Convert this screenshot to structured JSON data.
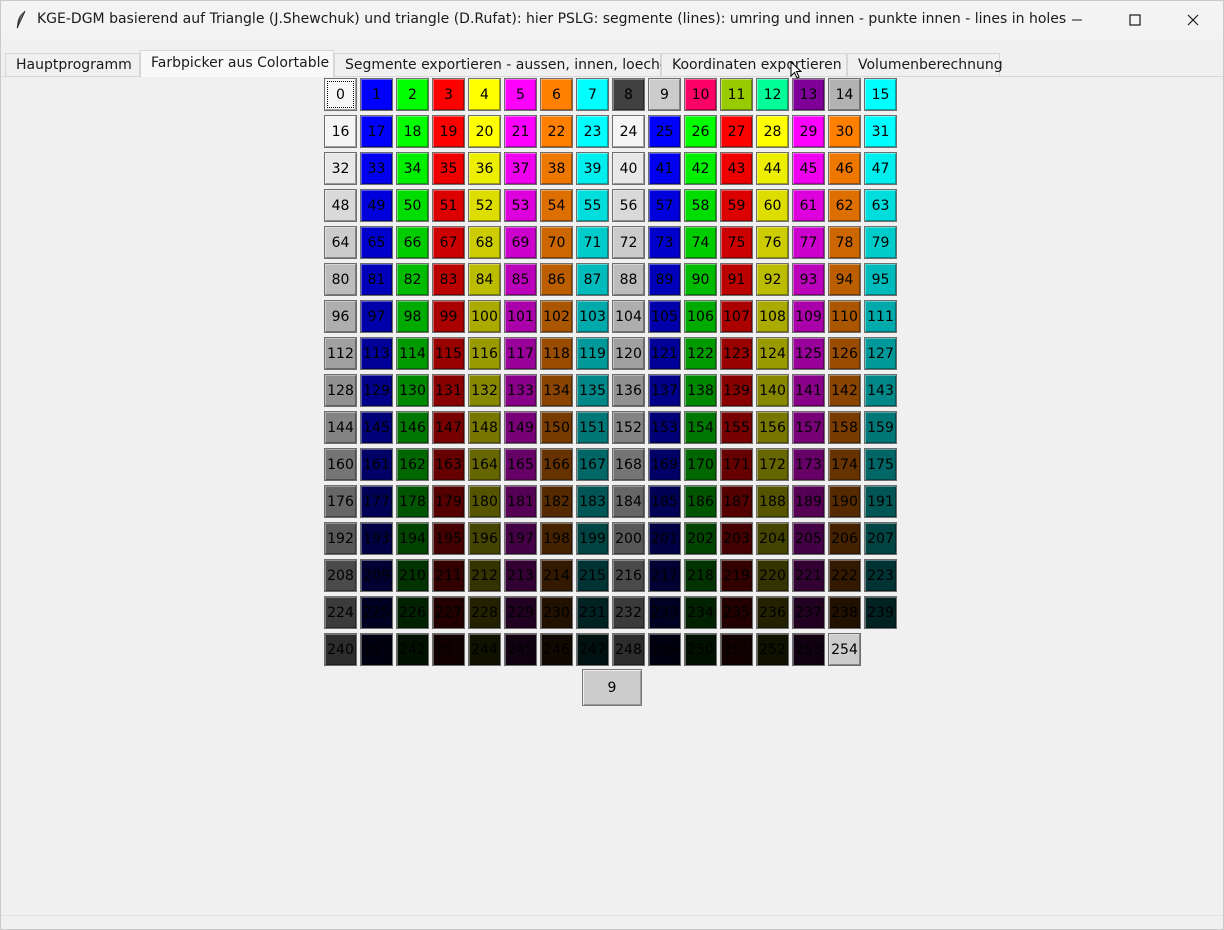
{
  "window": {
    "title": "KGE-DGM basierend auf Triangle (J.Shewchuk) und triangle (D.Rufat): hier PSLG: segmente (lines): umring und innen - punkte innen - lines in holes",
    "buttons": {
      "minimize": "minimize-icon",
      "maximize": "maximize-icon",
      "close": "close-icon"
    }
  },
  "tabs": [
    {
      "label": "Hauptprogramm",
      "active": false
    },
    {
      "label": "Farbpicker aus Colortable",
      "active": true
    },
    {
      "label": "Segmente exportieren - aussen, innen, loecher",
      "active": false
    },
    {
      "label": "Koordinaten exportieren",
      "active": false
    },
    {
      "label": "Volumenberechnung",
      "active": false
    }
  ],
  "colortable": {
    "columns": 16,
    "selected_index": 0,
    "cells": [
      {
        "label": "0",
        "color": "#f7f7f7"
      },
      {
        "label": "1",
        "color": "#0000ff"
      },
      {
        "label": "2",
        "color": "#00ff00"
      },
      {
        "label": "3",
        "color": "#ff0000"
      },
      {
        "label": "4",
        "color": "#ffff00"
      },
      {
        "label": "5",
        "color": "#ff00ff"
      },
      {
        "label": "6",
        "color": "#ff7f00"
      },
      {
        "label": "7",
        "color": "#00ffff"
      },
      {
        "label": "8",
        "color": "#414141"
      },
      {
        "label": "9",
        "color": "#cccccc"
      },
      {
        "label": "10",
        "color": "#ff0066"
      },
      {
        "label": "11",
        "color": "#99cc00"
      },
      {
        "label": "12",
        "color": "#00ff99"
      },
      {
        "label": "13",
        "color": "#7f0099"
      },
      {
        "label": "14",
        "color": "#b2b2b2"
      },
      {
        "label": "15",
        "color": "#00ffff"
      },
      {
        "label": "16",
        "color": "#f5f5f5"
      },
      {
        "label": "17",
        "color": "#0000ff"
      },
      {
        "label": "18",
        "color": "#00ff00"
      },
      {
        "label": "19",
        "color": "#ff0000"
      },
      {
        "label": "20",
        "color": "#ffff00"
      },
      {
        "label": "21",
        "color": "#ff00ff"
      },
      {
        "label": "22",
        "color": "#ff7f00"
      },
      {
        "label": "23",
        "color": "#00ffff"
      },
      {
        "label": "24",
        "color": "#f5f5f5"
      },
      {
        "label": "25",
        "color": "#0000ff"
      },
      {
        "label": "26",
        "color": "#00ff00"
      },
      {
        "label": "27",
        "color": "#ff0000"
      },
      {
        "label": "28",
        "color": "#ffff00"
      },
      {
        "label": "29",
        "color": "#ff00ff"
      },
      {
        "label": "30",
        "color": "#ff7f00"
      },
      {
        "label": "31",
        "color": "#00ffff"
      },
      {
        "label": "32",
        "color": "#e8e8e8"
      },
      {
        "label": "33",
        "color": "#0000ee"
      },
      {
        "label": "34",
        "color": "#00ee00"
      },
      {
        "label": "35",
        "color": "#ee0000"
      },
      {
        "label": "36",
        "color": "#eeee00"
      },
      {
        "label": "37",
        "color": "#ee00ee"
      },
      {
        "label": "38",
        "color": "#ee7700"
      },
      {
        "label": "39",
        "color": "#00eeee"
      },
      {
        "label": "40",
        "color": "#e8e8e8"
      },
      {
        "label": "41",
        "color": "#0000ee"
      },
      {
        "label": "42",
        "color": "#00ee00"
      },
      {
        "label": "43",
        "color": "#ee0000"
      },
      {
        "label": "44",
        "color": "#eeee00"
      },
      {
        "label": "45",
        "color": "#ee00ee"
      },
      {
        "label": "46",
        "color": "#ee7700"
      },
      {
        "label": "47",
        "color": "#00eeee"
      },
      {
        "label": "48",
        "color": "#d9d9d9"
      },
      {
        "label": "49",
        "color": "#0000dd"
      },
      {
        "label": "50",
        "color": "#00dd00"
      },
      {
        "label": "51",
        "color": "#dd0000"
      },
      {
        "label": "52",
        "color": "#dddd00"
      },
      {
        "label": "53",
        "color": "#dd00dd"
      },
      {
        "label": "54",
        "color": "#dd6f00"
      },
      {
        "label": "55",
        "color": "#00dddd"
      },
      {
        "label": "56",
        "color": "#d9d9d9"
      },
      {
        "label": "57",
        "color": "#0000dd"
      },
      {
        "label": "58",
        "color": "#00dd00"
      },
      {
        "label": "59",
        "color": "#dd0000"
      },
      {
        "label": "60",
        "color": "#dddd00"
      },
      {
        "label": "61",
        "color": "#dd00dd"
      },
      {
        "label": "62",
        "color": "#dd6f00"
      },
      {
        "label": "63",
        "color": "#00dddd"
      },
      {
        "label": "64",
        "color": "#cbcbcb"
      },
      {
        "label": "65",
        "color": "#0000cc"
      },
      {
        "label": "66",
        "color": "#00cc00"
      },
      {
        "label": "67",
        "color": "#cc0000"
      },
      {
        "label": "68",
        "color": "#cccc00"
      },
      {
        "label": "69",
        "color": "#cc00cc"
      },
      {
        "label": "70",
        "color": "#cc6600"
      },
      {
        "label": "71",
        "color": "#00cccc"
      },
      {
        "label": "72",
        "color": "#cbcbcb"
      },
      {
        "label": "73",
        "color": "#0000cc"
      },
      {
        "label": "74",
        "color": "#00cc00"
      },
      {
        "label": "75",
        "color": "#cc0000"
      },
      {
        "label": "76",
        "color": "#cccc00"
      },
      {
        "label": "77",
        "color": "#cc00cc"
      },
      {
        "label": "78",
        "color": "#cc6600"
      },
      {
        "label": "79",
        "color": "#00cccc"
      },
      {
        "label": "80",
        "color": "#bcbcbc"
      },
      {
        "label": "81",
        "color": "#0000bb"
      },
      {
        "label": "82",
        "color": "#00bb00"
      },
      {
        "label": "83",
        "color": "#bb0000"
      },
      {
        "label": "84",
        "color": "#bbbb00"
      },
      {
        "label": "85",
        "color": "#bb00bb"
      },
      {
        "label": "86",
        "color": "#bb5e00"
      },
      {
        "label": "87",
        "color": "#00bbbb"
      },
      {
        "label": "88",
        "color": "#bcbcbc"
      },
      {
        "label": "89",
        "color": "#0000bb"
      },
      {
        "label": "90",
        "color": "#00bb00"
      },
      {
        "label": "91",
        "color": "#bb0000"
      },
      {
        "label": "92",
        "color": "#bbbb00"
      },
      {
        "label": "93",
        "color": "#bb00bb"
      },
      {
        "label": "94",
        "color": "#bb5e00"
      },
      {
        "label": "95",
        "color": "#00bbbb"
      },
      {
        "label": "96",
        "color": "#aeaeae"
      },
      {
        "label": "97",
        "color": "#0000aa"
      },
      {
        "label": "98",
        "color": "#00aa00"
      },
      {
        "label": "99",
        "color": "#aa0000"
      },
      {
        "label": "100",
        "color": "#aaaa00"
      },
      {
        "label": "101",
        "color": "#aa00aa"
      },
      {
        "label": "102",
        "color": "#aa5500"
      },
      {
        "label": "103",
        "color": "#00aaaa"
      },
      {
        "label": "104",
        "color": "#aeaeae"
      },
      {
        "label": "105",
        "color": "#0000aa"
      },
      {
        "label": "106",
        "color": "#00aa00"
      },
      {
        "label": "107",
        "color": "#aa0000"
      },
      {
        "label": "108",
        "color": "#aaaa00"
      },
      {
        "label": "109",
        "color": "#aa00aa"
      },
      {
        "label": "110",
        "color": "#aa5500"
      },
      {
        "label": "111",
        "color": "#00aaaa"
      },
      {
        "label": "112",
        "color": "#a0a0a0"
      },
      {
        "label": "113",
        "color": "#000099"
      },
      {
        "label": "114",
        "color": "#009900"
      },
      {
        "label": "115",
        "color": "#990000"
      },
      {
        "label": "116",
        "color": "#999900"
      },
      {
        "label": "117",
        "color": "#990099"
      },
      {
        "label": "118",
        "color": "#994c00"
      },
      {
        "label": "119",
        "color": "#009999"
      },
      {
        "label": "120",
        "color": "#a0a0a0"
      },
      {
        "label": "121",
        "color": "#000099"
      },
      {
        "label": "122",
        "color": "#009900"
      },
      {
        "label": "123",
        "color": "#990000"
      },
      {
        "label": "124",
        "color": "#999900"
      },
      {
        "label": "125",
        "color": "#990099"
      },
      {
        "label": "126",
        "color": "#994c00"
      },
      {
        "label": "127",
        "color": "#009999"
      },
      {
        "label": "128",
        "color": "#919191"
      },
      {
        "label": "129",
        "color": "#000088"
      },
      {
        "label": "130",
        "color": "#008800"
      },
      {
        "label": "131",
        "color": "#880000"
      },
      {
        "label": "132",
        "color": "#888800"
      },
      {
        "label": "133",
        "color": "#880088"
      },
      {
        "label": "134",
        "color": "#884400"
      },
      {
        "label": "135",
        "color": "#008888"
      },
      {
        "label": "136",
        "color": "#919191"
      },
      {
        "label": "137",
        "color": "#000088"
      },
      {
        "label": "138",
        "color": "#008800"
      },
      {
        "label": "139",
        "color": "#880000"
      },
      {
        "label": "140",
        "color": "#888800"
      },
      {
        "label": "141",
        "color": "#880088"
      },
      {
        "label": "142",
        "color": "#884400"
      },
      {
        "label": "143",
        "color": "#008888"
      },
      {
        "label": "144",
        "color": "#838383"
      },
      {
        "label": "145",
        "color": "#000077"
      },
      {
        "label": "146",
        "color": "#007700"
      },
      {
        "label": "147",
        "color": "#770000"
      },
      {
        "label": "148",
        "color": "#777700"
      },
      {
        "label": "149",
        "color": "#770077"
      },
      {
        "label": "150",
        "color": "#773b00"
      },
      {
        "label": "151",
        "color": "#007777"
      },
      {
        "label": "152",
        "color": "#838383"
      },
      {
        "label": "153",
        "color": "#000077"
      },
      {
        "label": "154",
        "color": "#007700"
      },
      {
        "label": "155",
        "color": "#770000"
      },
      {
        "label": "156",
        "color": "#777700"
      },
      {
        "label": "157",
        "color": "#770077"
      },
      {
        "label": "158",
        "color": "#773b00"
      },
      {
        "label": "159",
        "color": "#007777"
      },
      {
        "label": "160",
        "color": "#757575"
      },
      {
        "label": "161",
        "color": "#000066"
      },
      {
        "label": "162",
        "color": "#006600"
      },
      {
        "label": "163",
        "color": "#660000"
      },
      {
        "label": "164",
        "color": "#666600"
      },
      {
        "label": "165",
        "color": "#660066"
      },
      {
        "label": "166",
        "color": "#663300"
      },
      {
        "label": "167",
        "color": "#006666"
      },
      {
        "label": "168",
        "color": "#757575"
      },
      {
        "label": "169",
        "color": "#000066"
      },
      {
        "label": "170",
        "color": "#006600"
      },
      {
        "label": "171",
        "color": "#660000"
      },
      {
        "label": "172",
        "color": "#666600"
      },
      {
        "label": "173",
        "color": "#660066"
      },
      {
        "label": "174",
        "color": "#663300"
      },
      {
        "label": "175",
        "color": "#006666"
      },
      {
        "label": "176",
        "color": "#666666"
      },
      {
        "label": "177",
        "color": "#000055"
      },
      {
        "label": "178",
        "color": "#005500"
      },
      {
        "label": "179",
        "color": "#550000"
      },
      {
        "label": "180",
        "color": "#555500"
      },
      {
        "label": "181",
        "color": "#550055"
      },
      {
        "label": "182",
        "color": "#552a00"
      },
      {
        "label": "183",
        "color": "#005555"
      },
      {
        "label": "184",
        "color": "#666666"
      },
      {
        "label": "185",
        "color": "#000055"
      },
      {
        "label": "186",
        "color": "#005500"
      },
      {
        "label": "187",
        "color": "#550000"
      },
      {
        "label": "188",
        "color": "#555500"
      },
      {
        "label": "189",
        "color": "#550055"
      },
      {
        "label": "190",
        "color": "#552a00"
      },
      {
        "label": "191",
        "color": "#005555"
      },
      {
        "label": "192",
        "color": "#585858"
      },
      {
        "label": "193",
        "color": "#000044"
      },
      {
        "label": "194",
        "color": "#004400"
      },
      {
        "label": "195",
        "color": "#440000"
      },
      {
        "label": "196",
        "color": "#444400"
      },
      {
        "label": "197",
        "color": "#440044"
      },
      {
        "label": "198",
        "color": "#442200"
      },
      {
        "label": "199",
        "color": "#004444"
      },
      {
        "label": "200",
        "color": "#585858"
      },
      {
        "label": "201",
        "color": "#000044"
      },
      {
        "label": "202",
        "color": "#004400"
      },
      {
        "label": "203",
        "color": "#440000"
      },
      {
        "label": "204",
        "color": "#444400"
      },
      {
        "label": "205",
        "color": "#440044"
      },
      {
        "label": "206",
        "color": "#442200"
      },
      {
        "label": "207",
        "color": "#004444"
      },
      {
        "label": "208",
        "color": "#4a4a4a"
      },
      {
        "label": "209",
        "color": "#000033"
      },
      {
        "label": "210",
        "color": "#003300"
      },
      {
        "label": "211",
        "color": "#330000"
      },
      {
        "label": "212",
        "color": "#333300"
      },
      {
        "label": "213",
        "color": "#330033"
      },
      {
        "label": "214",
        "color": "#331900"
      },
      {
        "label": "215",
        "color": "#003333"
      },
      {
        "label": "216",
        "color": "#4a4a4a"
      },
      {
        "label": "217",
        "color": "#000033"
      },
      {
        "label": "218",
        "color": "#003300"
      },
      {
        "label": "219",
        "color": "#330000"
      },
      {
        "label": "220",
        "color": "#333300"
      },
      {
        "label": "221",
        "color": "#330033"
      },
      {
        "label": "222",
        "color": "#331900"
      },
      {
        "label": "223",
        "color": "#003333"
      },
      {
        "label": "224",
        "color": "#3b3b3b"
      },
      {
        "label": "225",
        "color": "#000022"
      },
      {
        "label": "226",
        "color": "#002200"
      },
      {
        "label": "227",
        "color": "#220000"
      },
      {
        "label": "228",
        "color": "#222200"
      },
      {
        "label": "229",
        "color": "#220022"
      },
      {
        "label": "230",
        "color": "#221100"
      },
      {
        "label": "231",
        "color": "#002222"
      },
      {
        "label": "232",
        "color": "#3b3b3b"
      },
      {
        "label": "233",
        "color": "#000022"
      },
      {
        "label": "234",
        "color": "#002200"
      },
      {
        "label": "235",
        "color": "#220000"
      },
      {
        "label": "236",
        "color": "#222200"
      },
      {
        "label": "237",
        "color": "#220022"
      },
      {
        "label": "238",
        "color": "#221100"
      },
      {
        "label": "239",
        "color": "#002222"
      },
      {
        "label": "240",
        "color": "#2d2d2d"
      },
      {
        "label": "241",
        "color": "#000011"
      },
      {
        "label": "242",
        "color": "#001100"
      },
      {
        "label": "243",
        "color": "#110000"
      },
      {
        "label": "244",
        "color": "#111100"
      },
      {
        "label": "245",
        "color": "#110011"
      },
      {
        "label": "246",
        "color": "#110800"
      },
      {
        "label": "247",
        "color": "#001111"
      },
      {
        "label": "248",
        "color": "#2d2d2d"
      },
      {
        "label": "249",
        "color": "#000011"
      },
      {
        "label": "250",
        "color": "#001100"
      },
      {
        "label": "251",
        "color": "#110000"
      },
      {
        "label": "252",
        "color": "#111100"
      },
      {
        "label": "253",
        "color": "#110011"
      },
      {
        "label": "254",
        "color": "#cccccc"
      }
    ]
  },
  "selected_color_button": {
    "label": "9",
    "color": "#cdcdcd"
  }
}
